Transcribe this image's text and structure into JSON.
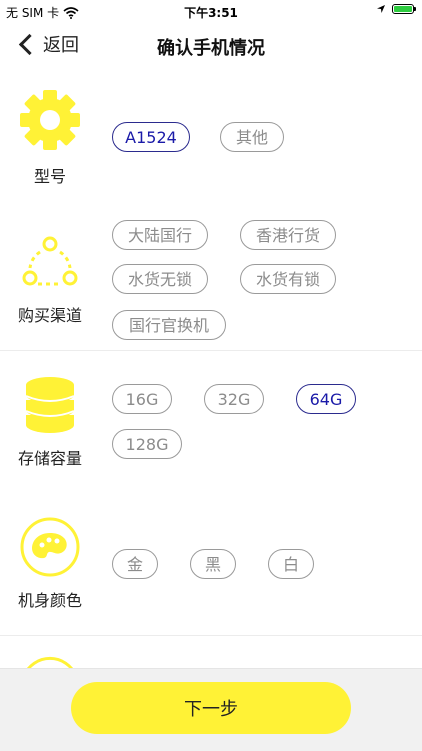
{
  "status_bar": {
    "carrier": "无 SIM 卡",
    "time": "下午3:51"
  },
  "nav": {
    "back_label": "返回",
    "title": "确认手机情况"
  },
  "sections": {
    "model": {
      "label": "型号",
      "options": [
        "A1524",
        "其他"
      ],
      "selected": "A1524"
    },
    "channel": {
      "label": "购买渠道",
      "options": [
        "大陆国行",
        "香港行货",
        "水货无锁",
        "水货有锁",
        "国行官换机"
      ]
    },
    "storage": {
      "label": "存储容量",
      "options": [
        "16G",
        "32G",
        "64G",
        "128G"
      ],
      "selected": "64G"
    },
    "color": {
      "label": "机身颜色",
      "options": [
        "金",
        "黑",
        "白"
      ]
    }
  },
  "footer": {
    "next_label": "下一步"
  },
  "colors": {
    "accent_yellow": "#fff236",
    "selected_blue": "#1a1aa8",
    "chip_gray": "#9a9a9a"
  }
}
